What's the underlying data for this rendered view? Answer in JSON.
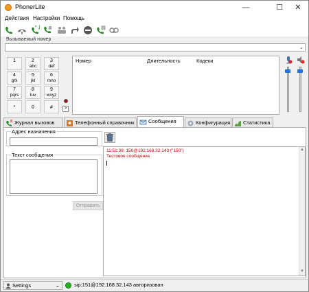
{
  "window": {
    "title": "PhonerLite"
  },
  "menu": [
    "Действия",
    "Настройки",
    "Помощь"
  ],
  "toolbar": [
    "call-icon",
    "hangup-icon",
    "redial-icon",
    "transfer-icon",
    "conference-icon",
    "forward-icon",
    "dnd-icon",
    "pickup-icon",
    "voicemail-icon"
  ],
  "dial": {
    "label": "Вызываемый номер",
    "value": ""
  },
  "keypad": [
    {
      "digit": "1",
      "letters": ""
    },
    {
      "digit": "2",
      "letters": "abc"
    },
    {
      "digit": "3",
      "letters": "def"
    },
    {
      "digit": "4",
      "letters": "ghi"
    },
    {
      "digit": "5",
      "letters": "jkl"
    },
    {
      "digit": "6",
      "letters": "mno"
    },
    {
      "digit": "7",
      "letters": "pqrs"
    },
    {
      "digit": "8",
      "letters": "tuv"
    },
    {
      "digit": "9",
      "letters": "wxyz"
    },
    {
      "digit": "*",
      "letters": ""
    },
    {
      "digit": "0",
      "letters": ""
    },
    {
      "digit": "#",
      "letters": ""
    }
  ],
  "more_label": ">",
  "calls_table": {
    "columns": [
      "Номер",
      "Длительность",
      "Кодеки"
    ]
  },
  "tabs": [
    {
      "label": "Журнал вызовов",
      "icon": "call-log-icon"
    },
    {
      "label": "Телефонный справочник",
      "icon": "phonebook-icon"
    },
    {
      "label": "Сообщения",
      "icon": "messages-icon",
      "active": true
    },
    {
      "label": "Конфигурация",
      "icon": "config-gear-icon"
    },
    {
      "label": "Статистика",
      "icon": "stats-icon"
    }
  ],
  "messages": {
    "dest_label": "Адрес назначения",
    "dest_value": "",
    "text_label": "Текст сообщения",
    "text_value": "",
    "send_label": "Отправить",
    "log": [
      "11:51:38: 150@192.168.32.143 (\"150\")",
      "Тестовое сообщение"
    ],
    "log_color": "#c00000"
  },
  "status": {
    "profile": "Settings",
    "text": "sip:151@192.168.32.143 авторизован",
    "led_color": "#27b224"
  }
}
